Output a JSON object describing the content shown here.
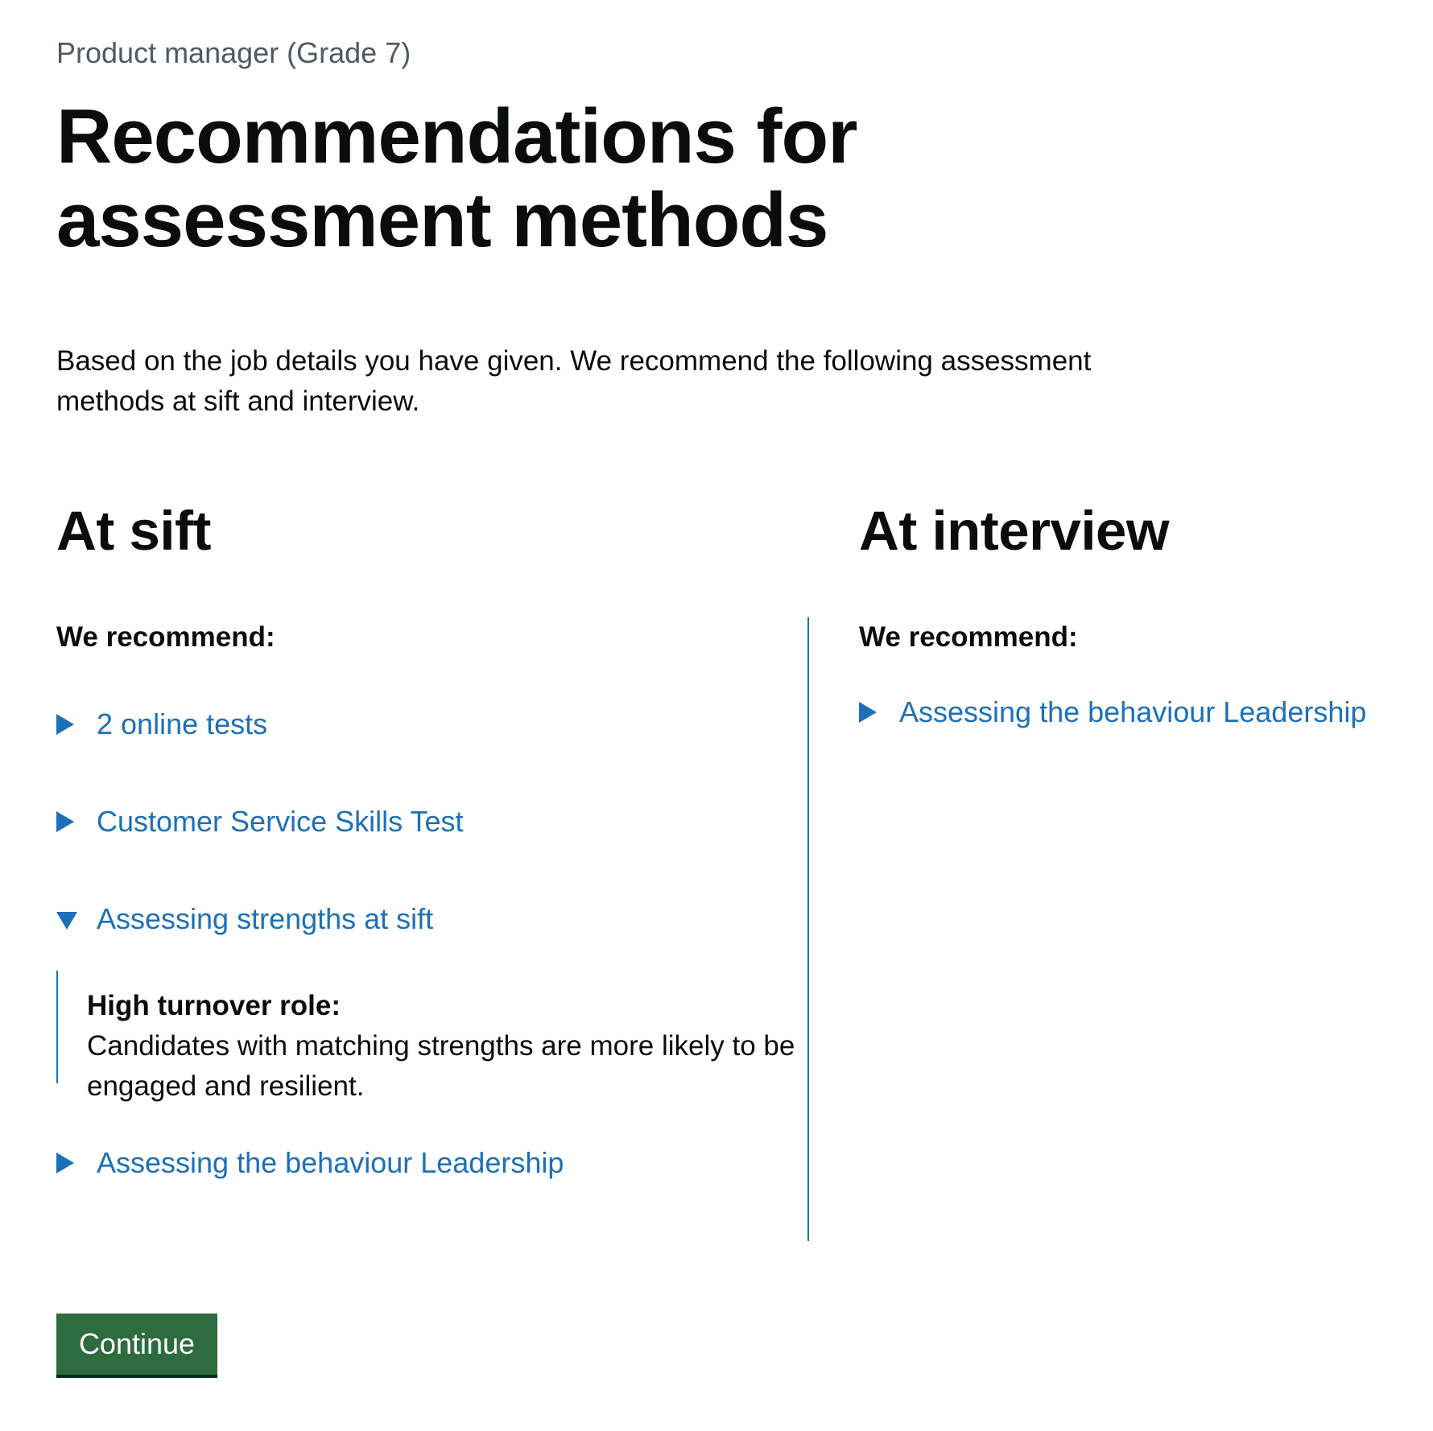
{
  "caption": "Product manager (Grade 7)",
  "title": "Recommendations for assessment methods",
  "intro": "Based on the job details you have given. We recommend the following assessment methods at sift and interview.",
  "sift": {
    "heading": "At sift",
    "recommend_label": "We recommend:",
    "items": [
      {
        "label": "2 online tests",
        "expanded": false
      },
      {
        "label": "Customer Service Skills Test",
        "expanded": false
      },
      {
        "label": "Assessing strengths at sift",
        "expanded": true,
        "panel": {
          "heading": "High turnover role:",
          "body": "Candidates with matching strengths are more likely to be engaged and resilient."
        }
      },
      {
        "label": "Assessing the behaviour Leadership",
        "expanded": false
      }
    ]
  },
  "interview": {
    "heading": "At interview",
    "recommend_label": "We recommend:",
    "items": [
      {
        "label": "Assessing the behaviour Leadership",
        "expanded": false
      }
    ]
  },
  "continue_label": "Continue",
  "colors": {
    "link": "#1d70b8",
    "button": "#2e6b3f",
    "text": "#0b0c0c",
    "caption": "#505a5f"
  },
  "icons": {
    "collapsed": "caret-right-icon",
    "expanded": "caret-down-icon"
  }
}
